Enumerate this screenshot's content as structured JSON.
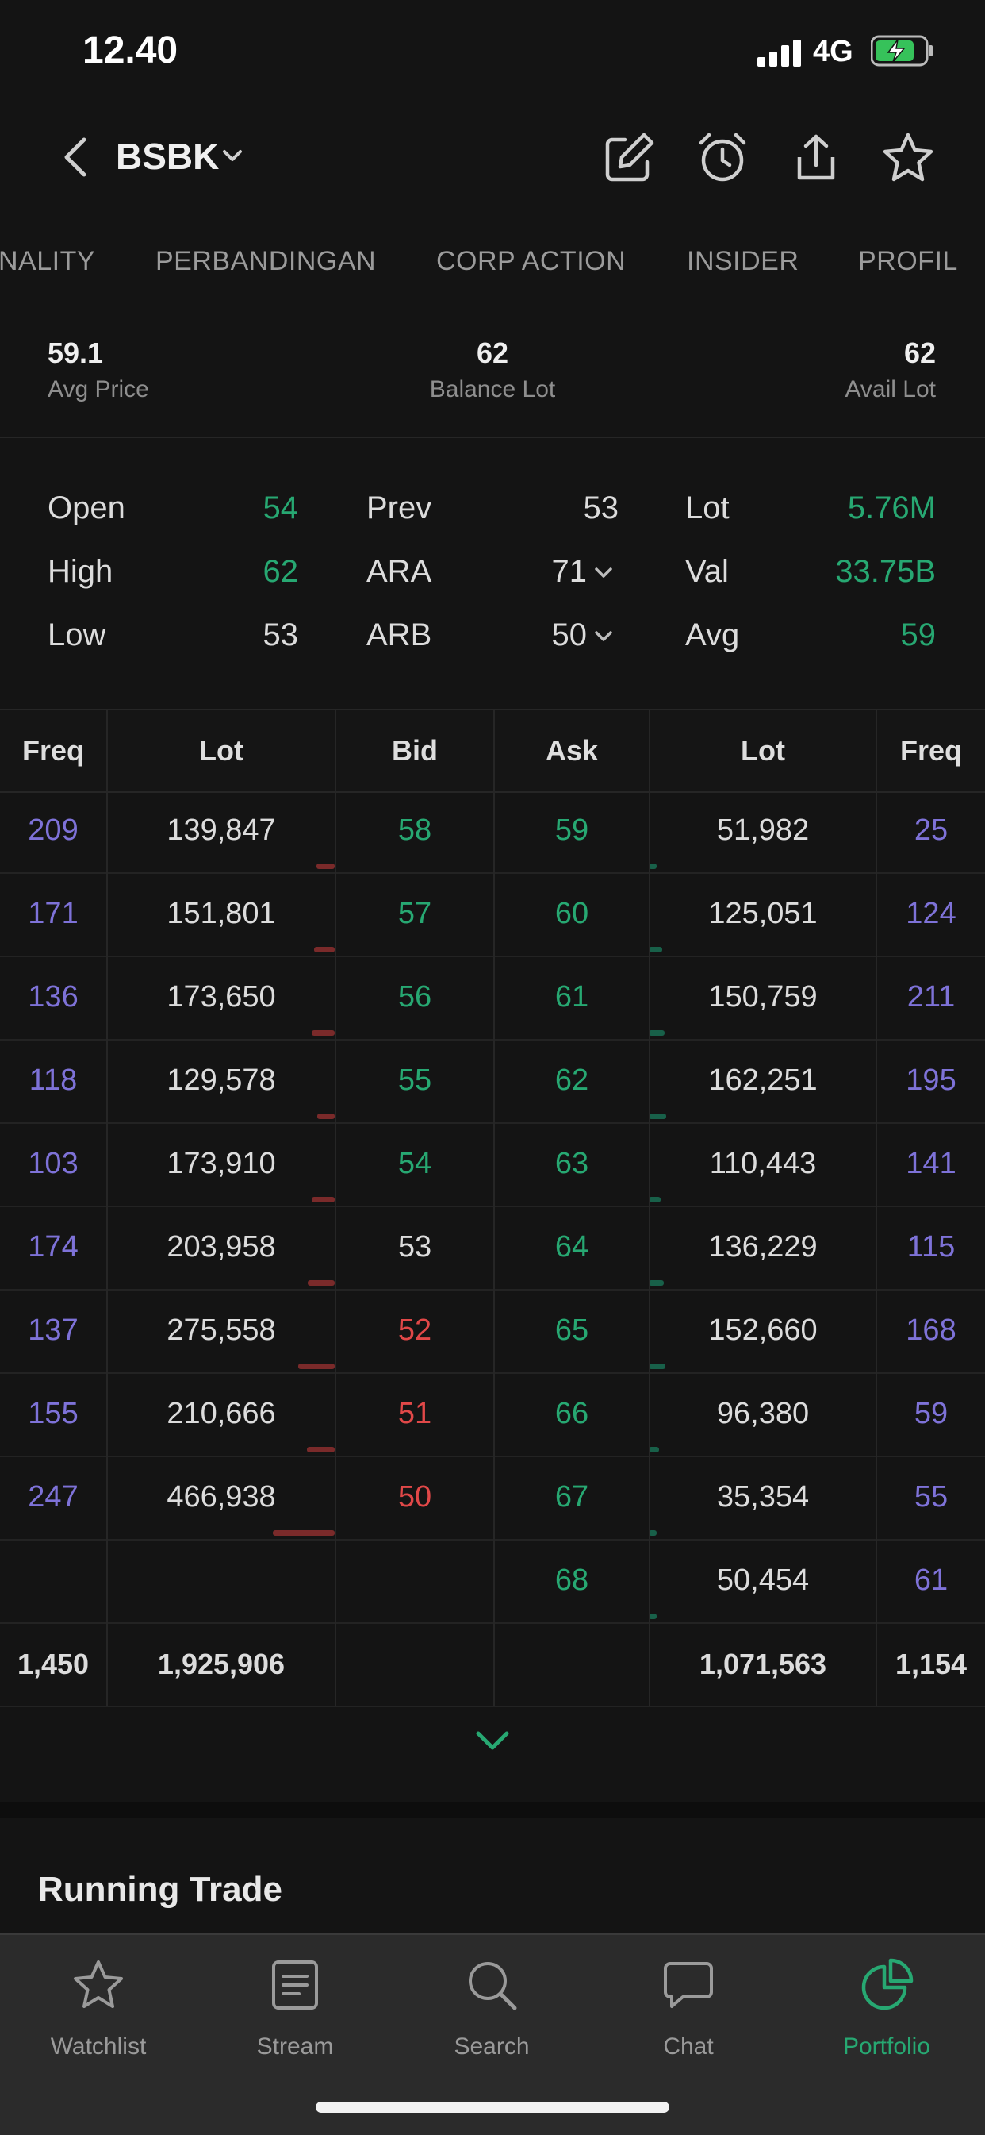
{
  "status_bar": {
    "time": "12.40",
    "network": "4G"
  },
  "header": {
    "ticker": "BSBK",
    "icons": [
      "edit-icon",
      "alarm-icon",
      "share-icon",
      "star-icon"
    ]
  },
  "tabs": [
    "NALITY",
    "PERBANDINGAN",
    "CORP ACTION",
    "INSIDER",
    "PROFIL"
  ],
  "summary": {
    "avg_price": {
      "value": "59.1",
      "label": "Avg Price"
    },
    "balance_lot": {
      "value": "62",
      "label": "Balance Lot"
    },
    "avail_lot": {
      "value": "62",
      "label": "Avail Lot"
    }
  },
  "stats": {
    "open": {
      "label": "Open",
      "value": "54"
    },
    "high": {
      "label": "High",
      "value": "62"
    },
    "low": {
      "label": "Low",
      "value": "53"
    },
    "prev": {
      "label": "Prev",
      "value": "53"
    },
    "ara": {
      "label": "ARA",
      "value": "71"
    },
    "arb": {
      "label": "ARB",
      "value": "50"
    },
    "lot": {
      "label": "Lot",
      "value": "5.76M"
    },
    "val": {
      "label": "Val",
      "value": "33.75B"
    },
    "avg": {
      "label": "Avg",
      "value": "59"
    }
  },
  "orderbook": {
    "headers": [
      "Freq",
      "Lot",
      "Bid",
      "Ask",
      "Lot",
      "Freq"
    ],
    "rows": [
      {
        "bid_freq": "209",
        "bid_lot": "139,847",
        "bid": "58",
        "bid_color": "green",
        "ask": "59",
        "ask_lot": "51,982",
        "ask_freq": "25",
        "bid_bar": 0.3,
        "ask_bar": 0.11
      },
      {
        "bid_freq": "171",
        "bid_lot": "151,801",
        "bid": "57",
        "bid_color": "green",
        "ask": "60",
        "ask_lot": "125,051",
        "ask_freq": "124",
        "bid_bar": 0.33,
        "ask_bar": 0.27
      },
      {
        "bid_freq": "136",
        "bid_lot": "173,650",
        "bid": "56",
        "bid_color": "green",
        "ask": "61",
        "ask_lot": "150,759",
        "ask_freq": "211",
        "bid_bar": 0.37,
        "ask_bar": 0.32
      },
      {
        "bid_freq": "118",
        "bid_lot": "129,578",
        "bid": "55",
        "bid_color": "green",
        "ask": "62",
        "ask_lot": "162,251",
        "ask_freq": "195",
        "bid_bar": 0.28,
        "ask_bar": 0.35
      },
      {
        "bid_freq": "103",
        "bid_lot": "173,910",
        "bid": "54",
        "bid_color": "green",
        "ask": "63",
        "ask_lot": "110,443",
        "ask_freq": "141",
        "bid_bar": 0.37,
        "ask_bar": 0.24
      },
      {
        "bid_freq": "174",
        "bid_lot": "203,958",
        "bid": "53",
        "bid_color": "white",
        "ask": "64",
        "ask_lot": "136,229",
        "ask_freq": "115",
        "bid_bar": 0.44,
        "ask_bar": 0.29
      },
      {
        "bid_freq": "137",
        "bid_lot": "275,558",
        "bid": "52",
        "bid_color": "red",
        "ask": "65",
        "ask_lot": "152,660",
        "ask_freq": "168",
        "bid_bar": 0.59,
        "ask_bar": 0.33
      },
      {
        "bid_freq": "155",
        "bid_lot": "210,666",
        "bid": "51",
        "bid_color": "red",
        "ask": "66",
        "ask_lot": "96,380",
        "ask_freq": "59",
        "bid_bar": 0.45,
        "ask_bar": 0.21
      },
      {
        "bid_freq": "247",
        "bid_lot": "466,938",
        "bid": "50",
        "bid_color": "red",
        "ask": "67",
        "ask_lot": "35,354",
        "ask_freq": "55",
        "bid_bar": 1.0,
        "ask_bar": 0.08
      },
      {
        "bid_freq": "",
        "bid_lot": "",
        "bid": "",
        "bid_color": "white",
        "ask": "68",
        "ask_lot": "50,454",
        "ask_freq": "61",
        "bid_bar": 0,
        "ask_bar": 0.11
      }
    ],
    "totals": {
      "bid_freq": "1,450",
      "bid_lot": "1,925,906",
      "ask_lot": "1,071,563",
      "ask_freq": "1,154"
    }
  },
  "running_trade": {
    "title": "Running Trade"
  },
  "bottom_nav": [
    {
      "label": "Watchlist",
      "icon": "star-icon"
    },
    {
      "label": "Stream",
      "icon": "stream-icon"
    },
    {
      "label": "Search",
      "icon": "search-icon"
    },
    {
      "label": "Chat",
      "icon": "chat-icon"
    },
    {
      "label": "Portfolio",
      "icon": "portfolio-icon",
      "active": true
    }
  ],
  "colors": {
    "green": "#27a872",
    "red": "#e14848",
    "purple": "#7e72d8",
    "background": "#141414"
  }
}
